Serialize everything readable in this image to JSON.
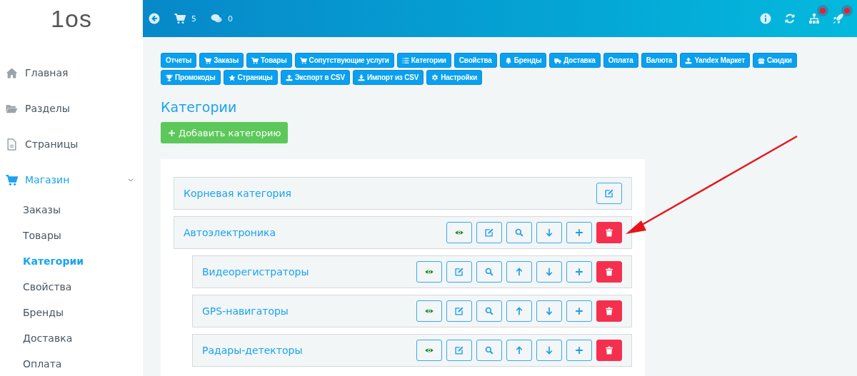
{
  "logo": {
    "text": "1os"
  },
  "topbar": {
    "left": [
      {
        "kind": "back"
      },
      {
        "kind": "cart",
        "count": "5"
      },
      {
        "kind": "chat",
        "count": "0"
      }
    ],
    "right": [
      {
        "kind": "info"
      },
      {
        "kind": "refresh"
      },
      {
        "kind": "sitemap",
        "badge": true
      },
      {
        "kind": "rocket",
        "badge": true
      }
    ]
  },
  "sidebar": {
    "items": [
      {
        "kind": "home",
        "label": "Главная",
        "selected": false
      },
      {
        "kind": "folder",
        "label": "Разделы",
        "selected": false
      },
      {
        "kind": "file",
        "label": "Страницы",
        "selected": false
      },
      {
        "kind": "cart",
        "label": "Магазин",
        "selected": true,
        "expanded": true,
        "children": [
          {
            "label": "Заказы",
            "selected": false
          },
          {
            "label": "Товары",
            "selected": false
          },
          {
            "label": "Категории",
            "selected": true
          },
          {
            "label": "Свойства",
            "selected": false
          },
          {
            "label": "Бренды",
            "selected": false
          },
          {
            "label": "Доставка",
            "selected": false
          },
          {
            "label": "Оплата",
            "selected": false
          }
        ]
      }
    ]
  },
  "toolbar": [
    {
      "label": "Отчеты"
    },
    {
      "kind": "cart",
      "label": "Заказы"
    },
    {
      "kind": "cart",
      "label": "Товары"
    },
    {
      "kind": "cart",
      "label": "Сопутствующие услуги"
    },
    {
      "kind": "list",
      "label": "Категории"
    },
    {
      "label": "Свойства"
    },
    {
      "kind": "bell",
      "label": "Бренды"
    },
    {
      "kind": "truck",
      "label": "Доставка"
    },
    {
      "label": "Оплата"
    },
    {
      "label": "Валюта"
    },
    {
      "kind": "upload",
      "label": "Yandex Маркет"
    },
    {
      "kind": "gift",
      "label": "Скидки"
    },
    {
      "kind": "trophy",
      "label": "Промокоды"
    },
    {
      "kind": "star",
      "label": "Страницы"
    },
    {
      "kind": "upload",
      "label": "Экспорт в CSV"
    },
    {
      "kind": "download",
      "label": "Импорт из CSV"
    },
    {
      "kind": "gear",
      "label": "Настройки"
    }
  ],
  "page_title": "Категории",
  "add_button": {
    "label": "Добавить категорию"
  },
  "categories": [
    {
      "name": "Корневая категория",
      "actions": [
        {
          "kind": "edit"
        }
      ]
    },
    {
      "name": "Автоэлектроника",
      "actions": [
        {
          "kind": "view"
        },
        {
          "kind": "edit"
        },
        {
          "kind": "search"
        },
        {
          "kind": "down"
        },
        {
          "kind": "add"
        },
        {
          "kind": "delete"
        }
      ],
      "children": [
        {
          "name": "Видеорегистраторы",
          "actions": [
            {
              "kind": "view"
            },
            {
              "kind": "edit"
            },
            {
              "kind": "search"
            },
            {
              "kind": "up"
            },
            {
              "kind": "down"
            },
            {
              "kind": "add"
            },
            {
              "kind": "delete"
            }
          ]
        },
        {
          "name": "GPS-навигаторы",
          "actions": [
            {
              "kind": "view"
            },
            {
              "kind": "edit"
            },
            {
              "kind": "search"
            },
            {
              "kind": "up"
            },
            {
              "kind": "down"
            },
            {
              "kind": "add"
            },
            {
              "kind": "delete"
            }
          ]
        },
        {
          "name": "Радары-детекторы",
          "actions": [
            {
              "kind": "view"
            },
            {
              "kind": "edit"
            },
            {
              "kind": "search"
            },
            {
              "kind": "up"
            },
            {
              "kind": "down"
            },
            {
              "kind": "add"
            },
            {
              "kind": "delete"
            }
          ]
        }
      ]
    }
  ]
}
